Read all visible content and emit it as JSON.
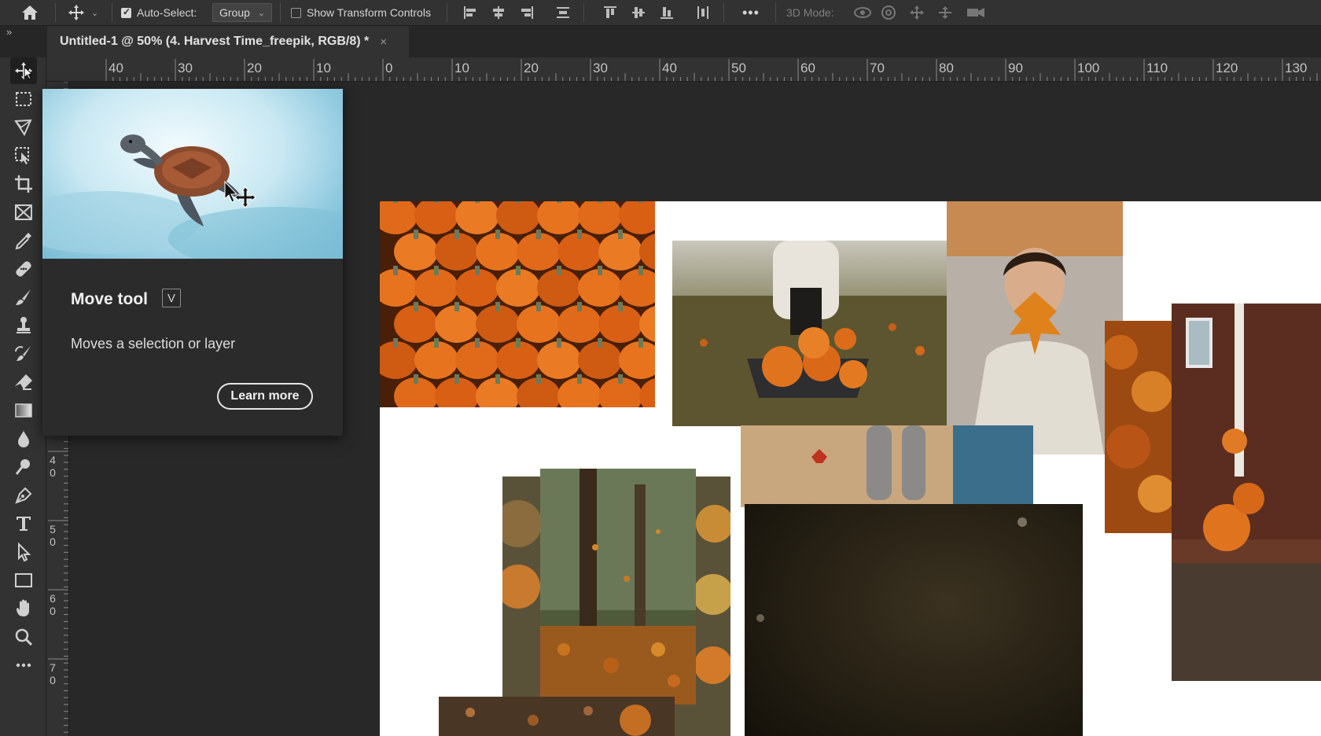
{
  "options_bar": {
    "auto_select_label": "Auto-Select:",
    "auto_select_checked": true,
    "group_option": "Group",
    "show_transform_label": "Show Transform Controls",
    "show_transform_checked": false,
    "more_label": "•••",
    "mode_3d_label": "3D Mode:"
  },
  "tab": {
    "collapse_label": "»",
    "doc_title": "Untitled-1 @ 50% (4. Harvest Time_freepik, RGB/8) *",
    "close_label": "×"
  },
  "ruler": {
    "h_labels": [
      "40",
      "30",
      "20",
      "10",
      "0",
      "10",
      "20",
      "30",
      "40",
      "50",
      "60",
      "70",
      "80",
      "90",
      "100",
      "110",
      "120",
      "130"
    ],
    "v_labels": [
      "4\n0",
      "5\n0",
      "6\n0",
      "7\n0"
    ]
  },
  "tools": [
    {
      "name": "move-tool-icon",
      "active": true
    },
    {
      "name": "rectangular-marquee-icon"
    },
    {
      "name": "lasso-icon"
    },
    {
      "name": "object-selection-icon"
    },
    {
      "name": "crop-icon"
    },
    {
      "name": "frame-icon"
    },
    {
      "name": "eyedropper-icon"
    },
    {
      "name": "healing-brush-icon"
    },
    {
      "name": "brush-icon"
    },
    {
      "name": "clone-stamp-icon"
    },
    {
      "name": "history-brush-icon"
    },
    {
      "name": "eraser-icon"
    },
    {
      "name": "gradient-icon"
    },
    {
      "name": "blur-icon"
    },
    {
      "name": "dodge-icon"
    },
    {
      "name": "pen-icon"
    },
    {
      "name": "type-icon"
    },
    {
      "name": "path-selection-icon"
    },
    {
      "name": "rectangle-icon"
    },
    {
      "name": "hand-icon"
    },
    {
      "name": "zoom-icon"
    },
    {
      "name": "more-tools-icon"
    }
  ],
  "tooltip": {
    "title": "Move tool",
    "shortcut": "V",
    "description": "Moves a selection or layer",
    "learn_more": "Learn more"
  },
  "colors": {
    "accent_pumpkin": "#e06a1a",
    "ui_panel": "#323232",
    "canvas_bg": "#282828"
  }
}
